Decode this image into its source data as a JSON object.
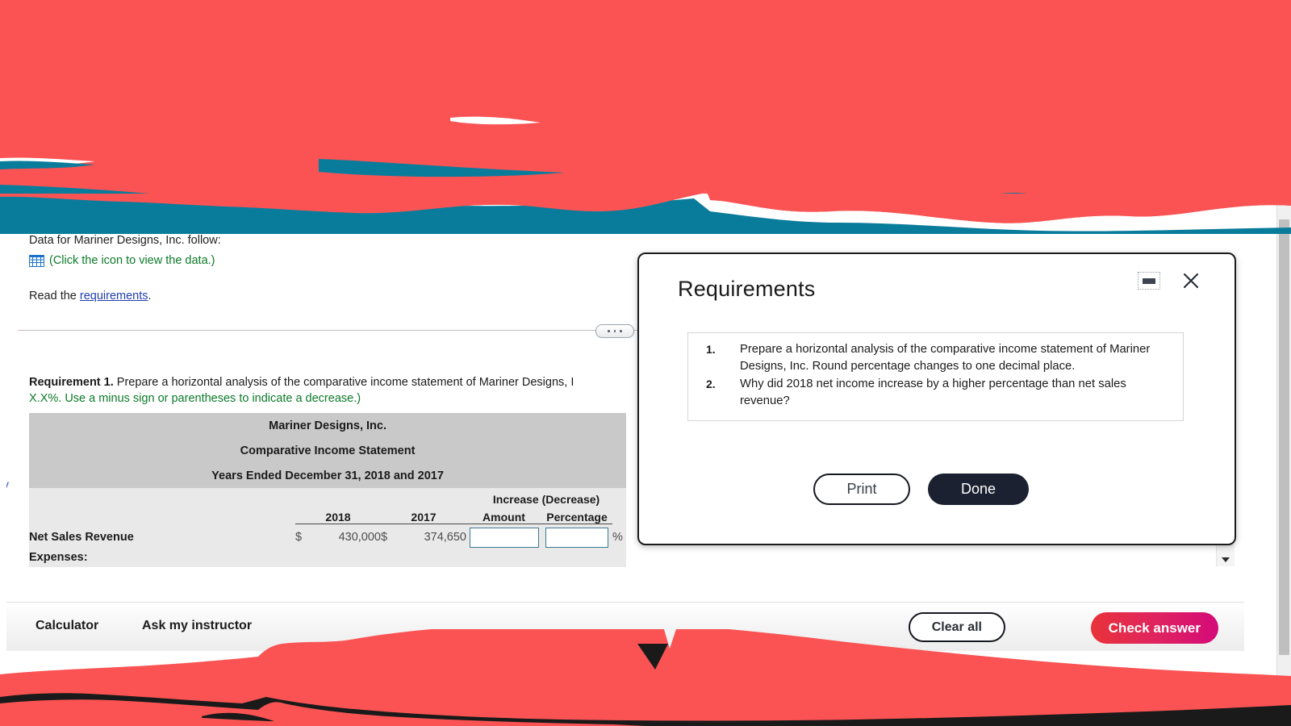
{
  "colors": {
    "occlusion_red": "#FB5353",
    "occlusion_teal": "#0A7C9B",
    "link_blue": "#1F3FB0",
    "instruction_green": "#0B7A28",
    "table_header_gray": "#C9C9C9",
    "table_body_gray": "#E9E9E9",
    "input_border": "#3D7A94",
    "check_answer_gradient_start": "#E8333A",
    "check_answer_gradient_end": "#D40A79",
    "done_button": "#1B2130"
  },
  "content": {
    "data_follow_text": "Data for Mariner Designs, Inc. follow:",
    "click_icon_text": "(Click the icon to view the data.)",
    "grid_icon_name": "table-grid-icon",
    "read_prefix": "Read the ",
    "read_link": "requirements",
    "read_suffix": ".",
    "splitter_handle_name": "splitter-drag-handle"
  },
  "requirement": {
    "label": "Requirement 1.",
    "body": " Prepare a horizontal analysis of the comparative income statement of Mariner Designs, I",
    "green_note": "X.X%. Use a minus sign or parentheses to indicate a decrease.)"
  },
  "table": {
    "title_line_1": "Mariner Designs, Inc.",
    "title_line_2": "Comparative Income Statement",
    "title_line_3": "Years Ended December 31, 2018 and 2017",
    "group_header": "Increase (Decrease)",
    "columns": [
      "",
      "2018",
      "2017",
      "Amount",
      "Percentage"
    ],
    "rows": [
      {
        "label": "Net Sales Revenue",
        "dollar_2018": "$",
        "value_2018": "430,000",
        "dollar_2017": "$",
        "value_2017": "374,650",
        "amount_input": "",
        "percentage_input": "",
        "percent_sign": "%"
      }
    ],
    "next_row_label": "Expenses:"
  },
  "left_clip_glyph": "v",
  "dialog": {
    "title": "Requirements",
    "minimize_icon": "minimize-icon",
    "close_icon": "close-icon",
    "items": [
      {
        "num": "1.",
        "text": "Prepare a horizontal analysis of the comparative income statement of Mariner Designs, Inc. Round percentage changes to one decimal place."
      },
      {
        "num": "2.",
        "text": "Why did 2018 net income increase by a higher percentage than net sales revenue?"
      }
    ],
    "print_label": "Print",
    "done_label": "Done"
  },
  "toolbar": {
    "calculator_label": "Calculator",
    "ask_instructor_label": "Ask my instructor",
    "clear_all_label": "Clear all",
    "check_answer_label": "Check answer"
  },
  "scrollbars": {
    "inner_up_icon": "scroll-up-arrow-icon",
    "inner_down_icon": "scroll-down-arrow-icon",
    "outer_down_icon": "scroll-down-arrow-icon"
  }
}
